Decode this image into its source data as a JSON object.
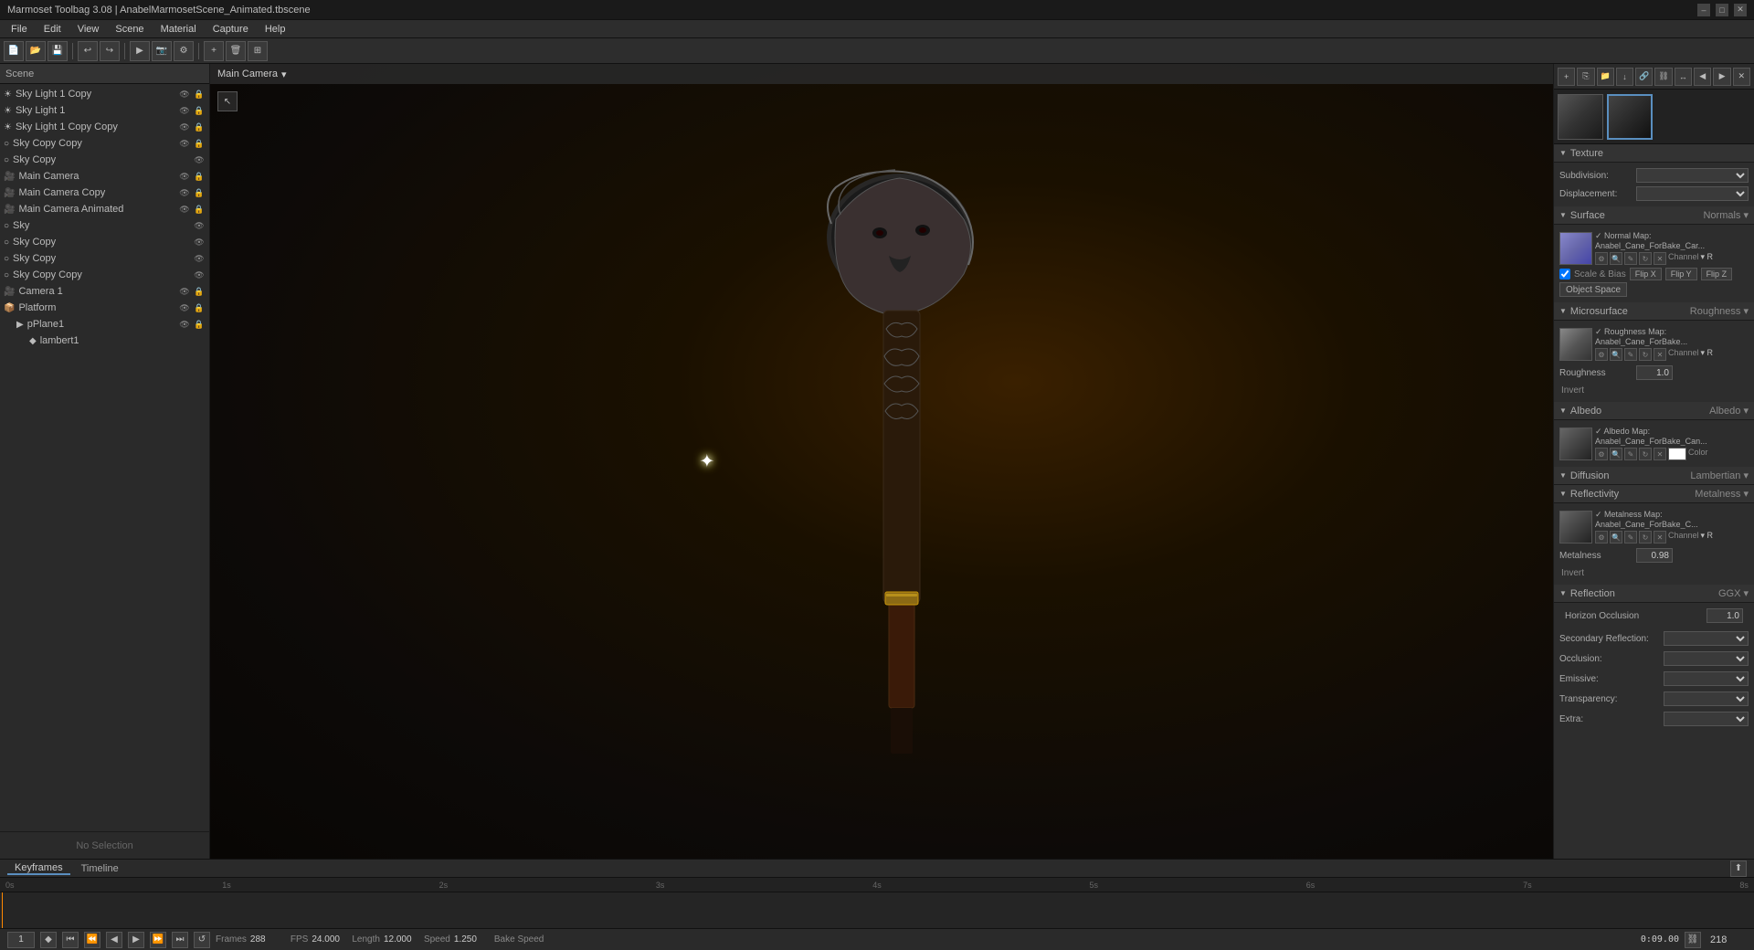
{
  "window": {
    "title": "Marmoset Toolbag 3.08 | AnabelMarmosetScene_Animated.tbscene",
    "controls": [
      "–",
      "□",
      "✕"
    ]
  },
  "menubar": {
    "items": [
      "File",
      "Edit",
      "View",
      "Scene",
      "Material",
      "Capture",
      "Help"
    ]
  },
  "camera_label": "Main Camera",
  "scene_tree": {
    "items": [
      {
        "id": "sky-light-1-copy",
        "label": "Sky Light 1 Copy",
        "indent": 0,
        "icon": "☀"
      },
      {
        "id": "sky-light-1",
        "label": "Sky Light 1",
        "indent": 0,
        "icon": "☀"
      },
      {
        "id": "sky-light-1-copy-copy",
        "label": "Sky Light 1 Copy Copy",
        "indent": 0,
        "icon": "☀"
      },
      {
        "id": "sky-copy-copy",
        "label": "Sky Copy Copy",
        "indent": 0,
        "icon": "🌐"
      },
      {
        "id": "sky-copy",
        "label": "Sky Copy",
        "indent": 0,
        "icon": "🌐"
      },
      {
        "id": "main-camera",
        "label": "Main Camera",
        "indent": 0,
        "icon": "🎥"
      },
      {
        "id": "main-camera-copy",
        "label": "Main Camera Copy",
        "indent": 0,
        "icon": "🎥"
      },
      {
        "id": "main-camera-animated",
        "label": "Main Camera Animated",
        "indent": 0,
        "icon": "🎥"
      },
      {
        "id": "sky",
        "label": "Sky",
        "indent": 0,
        "icon": "🌐"
      },
      {
        "id": "sky-copy2",
        "label": "Sky Copy",
        "indent": 0,
        "icon": "🌐"
      },
      {
        "id": "sky-copy3",
        "label": "Sky Copy",
        "indent": 0,
        "icon": "🌐"
      },
      {
        "id": "sky-copy-copy2",
        "label": "Sky Copy Copy",
        "indent": 0,
        "icon": "🌐"
      },
      {
        "id": "camera-1",
        "label": "Camera 1",
        "indent": 0,
        "icon": "🎥"
      },
      {
        "id": "platform",
        "label": "Platform",
        "indent": 0,
        "icon": "📦"
      },
      {
        "id": "pplane1",
        "label": "pPlane1",
        "indent": 1,
        "icon": "📄"
      },
      {
        "id": "lambert1",
        "label": "lambert1",
        "indent": 2,
        "icon": "🔸"
      }
    ]
  },
  "selection_info": "No Selection",
  "right_panel": {
    "sections": {
      "texture": {
        "label": "Texture",
        "subdivision_label": "Subdivision:",
        "displacement_label": "Displacement:"
      },
      "surface": {
        "label": "Surface",
        "right_label": "Normals ▾",
        "normal_map": {
          "label": "✓ Normal Map:",
          "name": "Anabel_Cane_ForBake_Car...",
          "channel_label": "Channel",
          "channel_value": "▾ R"
        },
        "scale_bias": "Scale & Bias",
        "flip_x": "Flip X",
        "flip_y": "Flip Y",
        "flip_z": "Flip Z",
        "object_space": "Object Space"
      },
      "microsurface": {
        "label": "Microsurface",
        "right_label": "Roughness ▾",
        "roughness_map": {
          "label": "✓ Roughness Map:",
          "name": "Anabel_Cane_ForBake...",
          "channel_label": "Channel",
          "channel_value": "▾ R"
        },
        "roughness_label": "Roughness",
        "roughness_value": "1.0",
        "invert": "Invert"
      },
      "albedo": {
        "label": "Albedo",
        "right_label": "Albedo ▾",
        "albedo_map": {
          "label": "✓ Albedo Map:",
          "name": "Anabel_Cane_ForBake_Can...",
          "color_label": "Color"
        }
      },
      "diffusion": {
        "label": "Diffusion",
        "right_label": "Lambertian ▾"
      },
      "reflectivity": {
        "label": "Reflectivity",
        "right_label": "Metalness ▾",
        "metalness_map": {
          "label": "✓ Metalness Map:",
          "name": "Anabel_Cane_ForBake_C...",
          "channel_label": "Channel",
          "channel_value": "▾ R"
        },
        "metalness_label": "Metalness",
        "metalness_value": "0.98",
        "invert": "Invert"
      },
      "reflection": {
        "label": "Reflection",
        "right_label": "GGX ▾",
        "horizon_occlusion_label": "Horizon Occlusion",
        "horizon_occlusion_value": "1.0",
        "secondary_reflection": "Secondary Reflection:",
        "occlusion": "Occlusion:",
        "emissive": "Emissive:",
        "transparency": "Transparency:",
        "extra": "Extra:"
      }
    }
  },
  "timeline": {
    "keyframes_tab": "Keyframes",
    "timeline_tab": "Timeline",
    "ruler_marks": [
      "0s",
      "1s",
      "2s",
      "3s",
      "4s",
      "5s",
      "6s",
      "7s",
      "8s"
    ],
    "time_display": "0:09.00",
    "frames_label": "Frames",
    "frames_value": "288",
    "fps_label": "FPS",
    "fps_value": "24.000",
    "length_label": "Length",
    "length_value": "12.000",
    "speed_label": "Speed",
    "speed_value": "1.250",
    "bake_speed_label": "Bake Speed",
    "frame_number": "1",
    "bake_value": "218"
  }
}
